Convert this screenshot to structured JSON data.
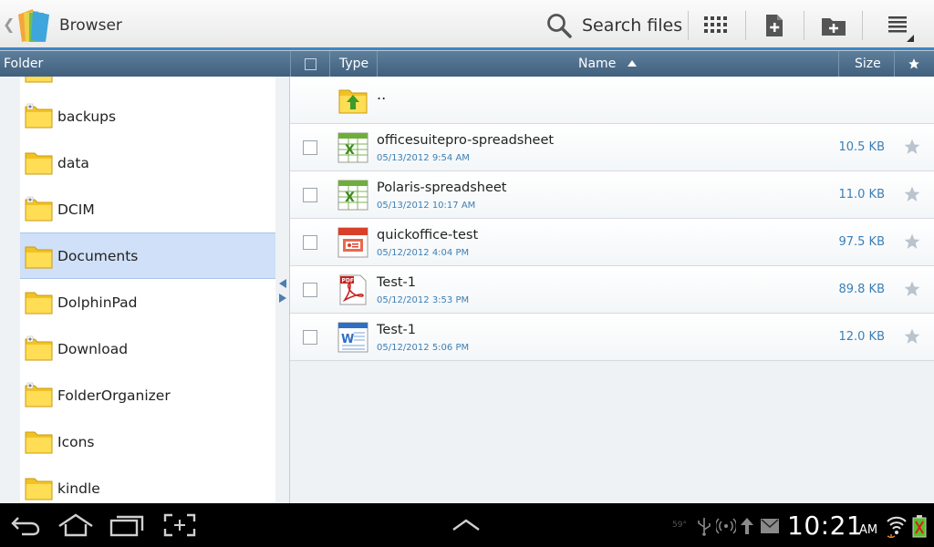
{
  "app": {
    "title": "Browser"
  },
  "toolbar": {
    "search_label": "Search files",
    "icons": [
      "search-icon",
      "grid-view-icon",
      "new-file-icon",
      "new-folder-icon",
      "menu-icon"
    ]
  },
  "columns": {
    "folder": "Folder",
    "type": "Type",
    "name": "Name",
    "size": "Size"
  },
  "folders": [
    {
      "name": "backups",
      "badge": true
    },
    {
      "name": "data",
      "badge": false
    },
    {
      "name": "DCIM",
      "badge": true
    },
    {
      "name": "Documents",
      "badge": false,
      "selected": true
    },
    {
      "name": "DolphinPad",
      "badge": false
    },
    {
      "name": "Download",
      "badge": true
    },
    {
      "name": "FolderOrganizer",
      "badge": true
    },
    {
      "name": "Icons",
      "badge": false
    },
    {
      "name": "kindle",
      "badge": false
    }
  ],
  "parent_row": {
    "label": ".."
  },
  "files": [
    {
      "name": "officesuitepro-spreadsheet",
      "date": "05/13/2012 9:54 AM",
      "size": "10.5 KB",
      "type_icon": "excel-icon"
    },
    {
      "name": "Polaris-spreadsheet",
      "date": "05/13/2012 10:17 AM",
      "size": "11.0 KB",
      "type_icon": "excel-icon"
    },
    {
      "name": "quickoffice-test",
      "date": "05/12/2012 4:04 PM",
      "size": "97.5 KB",
      "type_icon": "powerpoint-icon"
    },
    {
      "name": "Test-1",
      "date": "05/12/2012 3:53 PM",
      "size": "89.8 KB",
      "type_icon": "pdf-icon"
    },
    {
      "name": "Test-1",
      "date": "05/12/2012 5:06 PM",
      "size": "12.0 KB",
      "type_icon": "word-icon"
    }
  ],
  "status": {
    "time": "10:21",
    "ampm": "AM",
    "temperature": "59°"
  },
  "colors": {
    "accent": "#3d86c6",
    "header": "#4f6f8d",
    "selected": "#cfe0f8",
    "meta_text": "#3d7fb4"
  }
}
